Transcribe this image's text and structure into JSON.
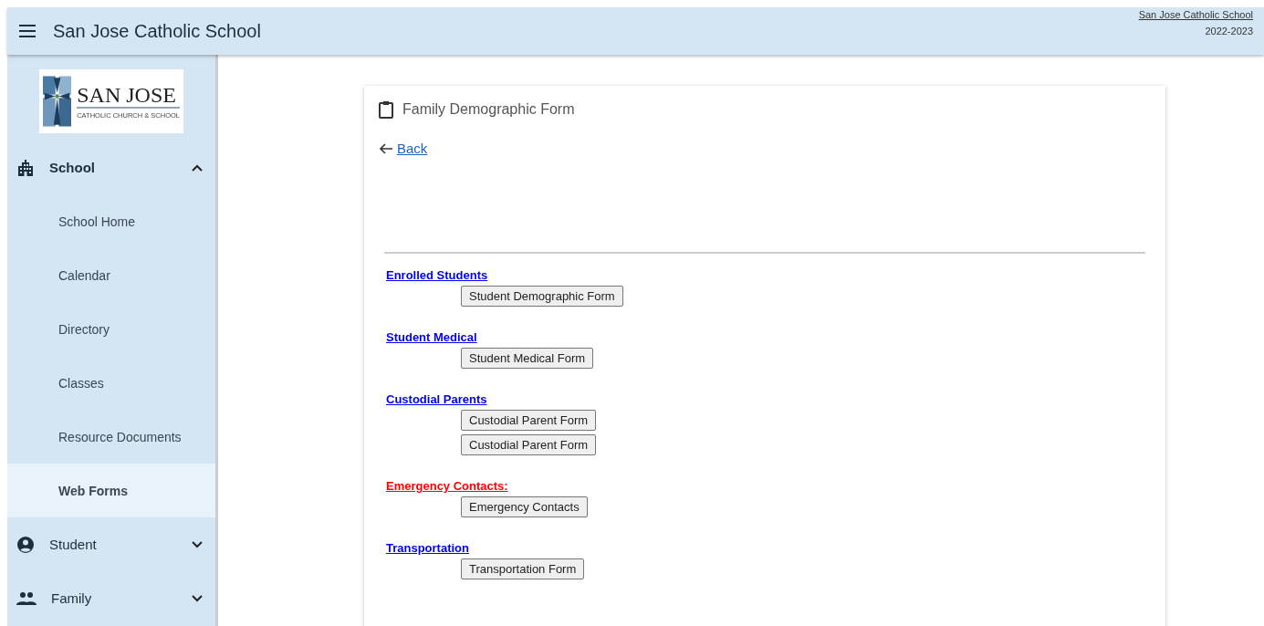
{
  "header": {
    "title": "San Jose Catholic School",
    "school_link": "San Jose Catholic School",
    "year": "2022-2023"
  },
  "logo": {
    "name": "SAN JOSE",
    "subtitle": "CATHOLIC CHURCH & SCHOOL"
  },
  "sidebar": {
    "sections": [
      {
        "label": "School",
        "kind": "building",
        "expanded": true,
        "items": [
          {
            "label": "School Home",
            "selected": false
          },
          {
            "label": "Calendar",
            "selected": false
          },
          {
            "label": "Directory",
            "selected": false
          },
          {
            "label": "Classes",
            "selected": false
          },
          {
            "label": "Resource Documents",
            "selected": false
          },
          {
            "label": "Web Forms",
            "selected": true
          }
        ]
      },
      {
        "label": "Student",
        "kind": "person",
        "expanded": false
      },
      {
        "label": "Family",
        "kind": "people",
        "expanded": false
      }
    ]
  },
  "card": {
    "title": "Family Demographic Form",
    "back": "Back",
    "sections": [
      {
        "heading": "Enrolled Students",
        "color": "#0000ee",
        "buttons": [
          "Student Demographic Form"
        ]
      },
      {
        "heading": "Student Medical",
        "color": "#0000ee",
        "buttons": [
          "Student Medical Form"
        ]
      },
      {
        "heading": "Custodial Parents",
        "color": "#0000ee",
        "buttons": [
          "Custodial Parent Form",
          "Custodial Parent Form"
        ]
      },
      {
        "heading": "Emergency Contacts:",
        "color": "#ff0000",
        "buttons": [
          "Emergency Contacts"
        ]
      },
      {
        "heading": "Transportation",
        "color": "#0000ee",
        "buttons": [
          "Transportation Form"
        ]
      }
    ]
  }
}
